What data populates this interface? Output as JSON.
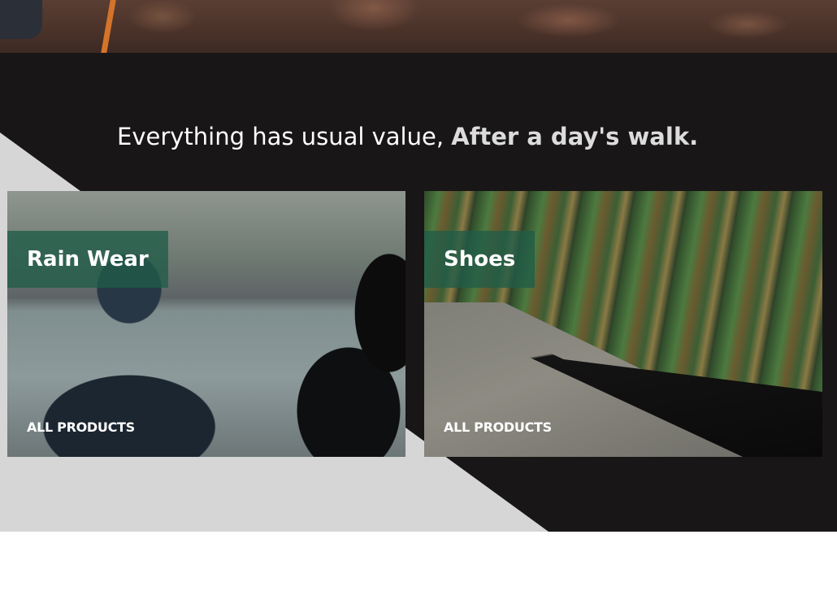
{
  "headline": {
    "normal": "Everything has usual value, ",
    "accent": "After a day's walk."
  },
  "cards": [
    {
      "title": "Rain Wear",
      "link": "ALL PRODUCTS"
    },
    {
      "title": "Shoes",
      "link": "ALL PRODUCTS"
    }
  ],
  "colors": {
    "dark_background": "#181617",
    "diagonal_light": "#d6d6d6",
    "title_overlay": "#205c48"
  }
}
